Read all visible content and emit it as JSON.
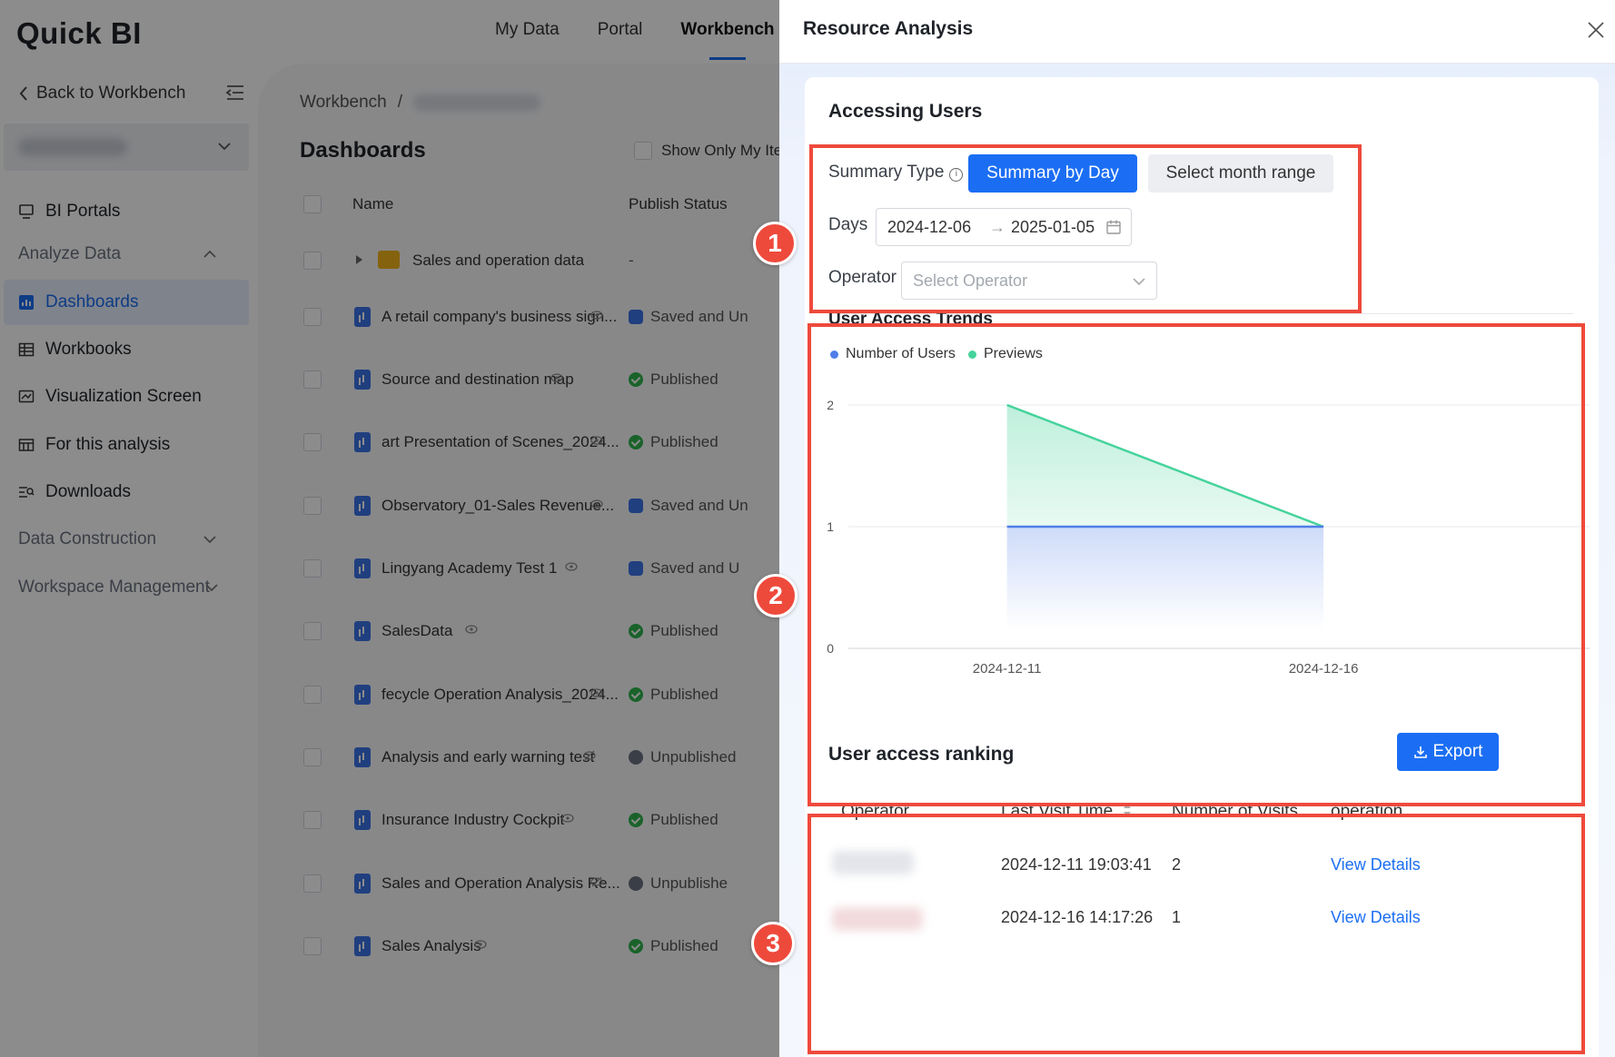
{
  "app": {
    "logo": "Quick BI",
    "top_nav": [
      "My Data",
      "Portal",
      "Workbench"
    ],
    "active_top_nav": "Workbench"
  },
  "sidebar": {
    "back_label": "Back to Workbench",
    "items": [
      {
        "label": "BI Portals",
        "icon": "monitor-icon"
      },
      {
        "label": "Analyze Data",
        "group": true,
        "expanded": true
      },
      {
        "label": "Dashboards",
        "icon": "bar-chart-icon",
        "active": true
      },
      {
        "label": "Workbooks",
        "icon": "table-icon"
      },
      {
        "label": "Visualization Screen",
        "icon": "screen-chart-icon"
      },
      {
        "label": "For this analysis",
        "icon": "grid-icon"
      },
      {
        "label": "Downloads",
        "icon": "download-list-icon"
      },
      {
        "label": "Data Construction",
        "group": true,
        "expanded": false
      },
      {
        "label": "Workspace Management",
        "group": true,
        "expanded": false
      }
    ]
  },
  "content": {
    "breadcrumb": "Workbench",
    "breadcrumb_sep": "/",
    "title": "Dashboards",
    "show_only_label": "Show Only My Ite",
    "columns": {
      "name": "Name",
      "status": "Publish Status"
    },
    "rows": [
      {
        "name": "Sales and operation data",
        "type": "folder",
        "status": "-"
      },
      {
        "name": "A retail company's business sign...",
        "status": "Saved and Un",
        "status_kind": "saved"
      },
      {
        "name": "Source and destination map",
        "status": "Published",
        "status_kind": "pub"
      },
      {
        "name": "art Presentation of Scenes_2024...",
        "status": "Published",
        "status_kind": "pub"
      },
      {
        "name": "Observatory_01-Sales Revenue...",
        "status": "Saved and Un",
        "status_kind": "saved"
      },
      {
        "name": "Lingyang Academy Test 1",
        "status": "Saved and U",
        "status_kind": "saved"
      },
      {
        "name": "SalesData",
        "status": "Published",
        "status_kind": "pub"
      },
      {
        "name": "fecycle Operation Analysis_2024...",
        "status": "Published",
        "status_kind": "pub"
      },
      {
        "name": "Analysis and early warning test",
        "status": "Unpublished",
        "status_kind": "unpub"
      },
      {
        "name": "Insurance Industry Cockpit",
        "status": "Published",
        "status_kind": "pub"
      },
      {
        "name": "Sales and Operation Analysis Re...",
        "status": "Unpublishe",
        "status_kind": "unpub"
      },
      {
        "name": "Sales Analysis",
        "status": "Published",
        "status_kind": "pub"
      }
    ]
  },
  "drawer": {
    "title": "Resource Analysis",
    "accessing_users": {
      "title": "Accessing Users",
      "summary_type_label": "Summary Type",
      "summary_by_day": "Summary by Day",
      "select_month_range": "Select month range",
      "days_label": "Days",
      "start_date": "2024-12-06",
      "range_arrow": "→",
      "end_date": "2025-01-05",
      "operator_label": "Operator",
      "operator_placeholder": "Select Operator"
    },
    "trends": {
      "title": "User Access Trends",
      "legend_users": "Number of Users",
      "legend_previews": "Previews",
      "y_ticks": [
        "2",
        "1",
        "0"
      ],
      "x_ticks": [
        "2024-12-11",
        "2024-12-16"
      ]
    },
    "ranking": {
      "title": "User access ranking",
      "export_label": "Export",
      "columns": [
        "Operator",
        "Last Visit Time",
        "Number of Visits",
        "operation"
      ],
      "rows": [
        {
          "last_visit": "2024-12-11 19:03:41",
          "visits": "2",
          "action": "View Details"
        },
        {
          "last_visit": "2024-12-16 14:17:26",
          "visits": "1",
          "action": "View Details"
        }
      ]
    },
    "annotations": [
      "1",
      "2",
      "3"
    ]
  },
  "chart_data": {
    "type": "area",
    "x": [
      "2024-12-11",
      "2024-12-16"
    ],
    "series": [
      {
        "name": "Number of Users",
        "values": [
          1,
          1
        ],
        "color": "#4f7ee8"
      },
      {
        "name": "Previews",
        "values": [
          2,
          1
        ],
        "color": "#45d39b"
      }
    ],
    "ylim": [
      0,
      2
    ],
    "grid": true,
    "legend": "top-left"
  },
  "colors": {
    "accent": "#1b6ef3",
    "annotation": "#ee4a3c"
  }
}
